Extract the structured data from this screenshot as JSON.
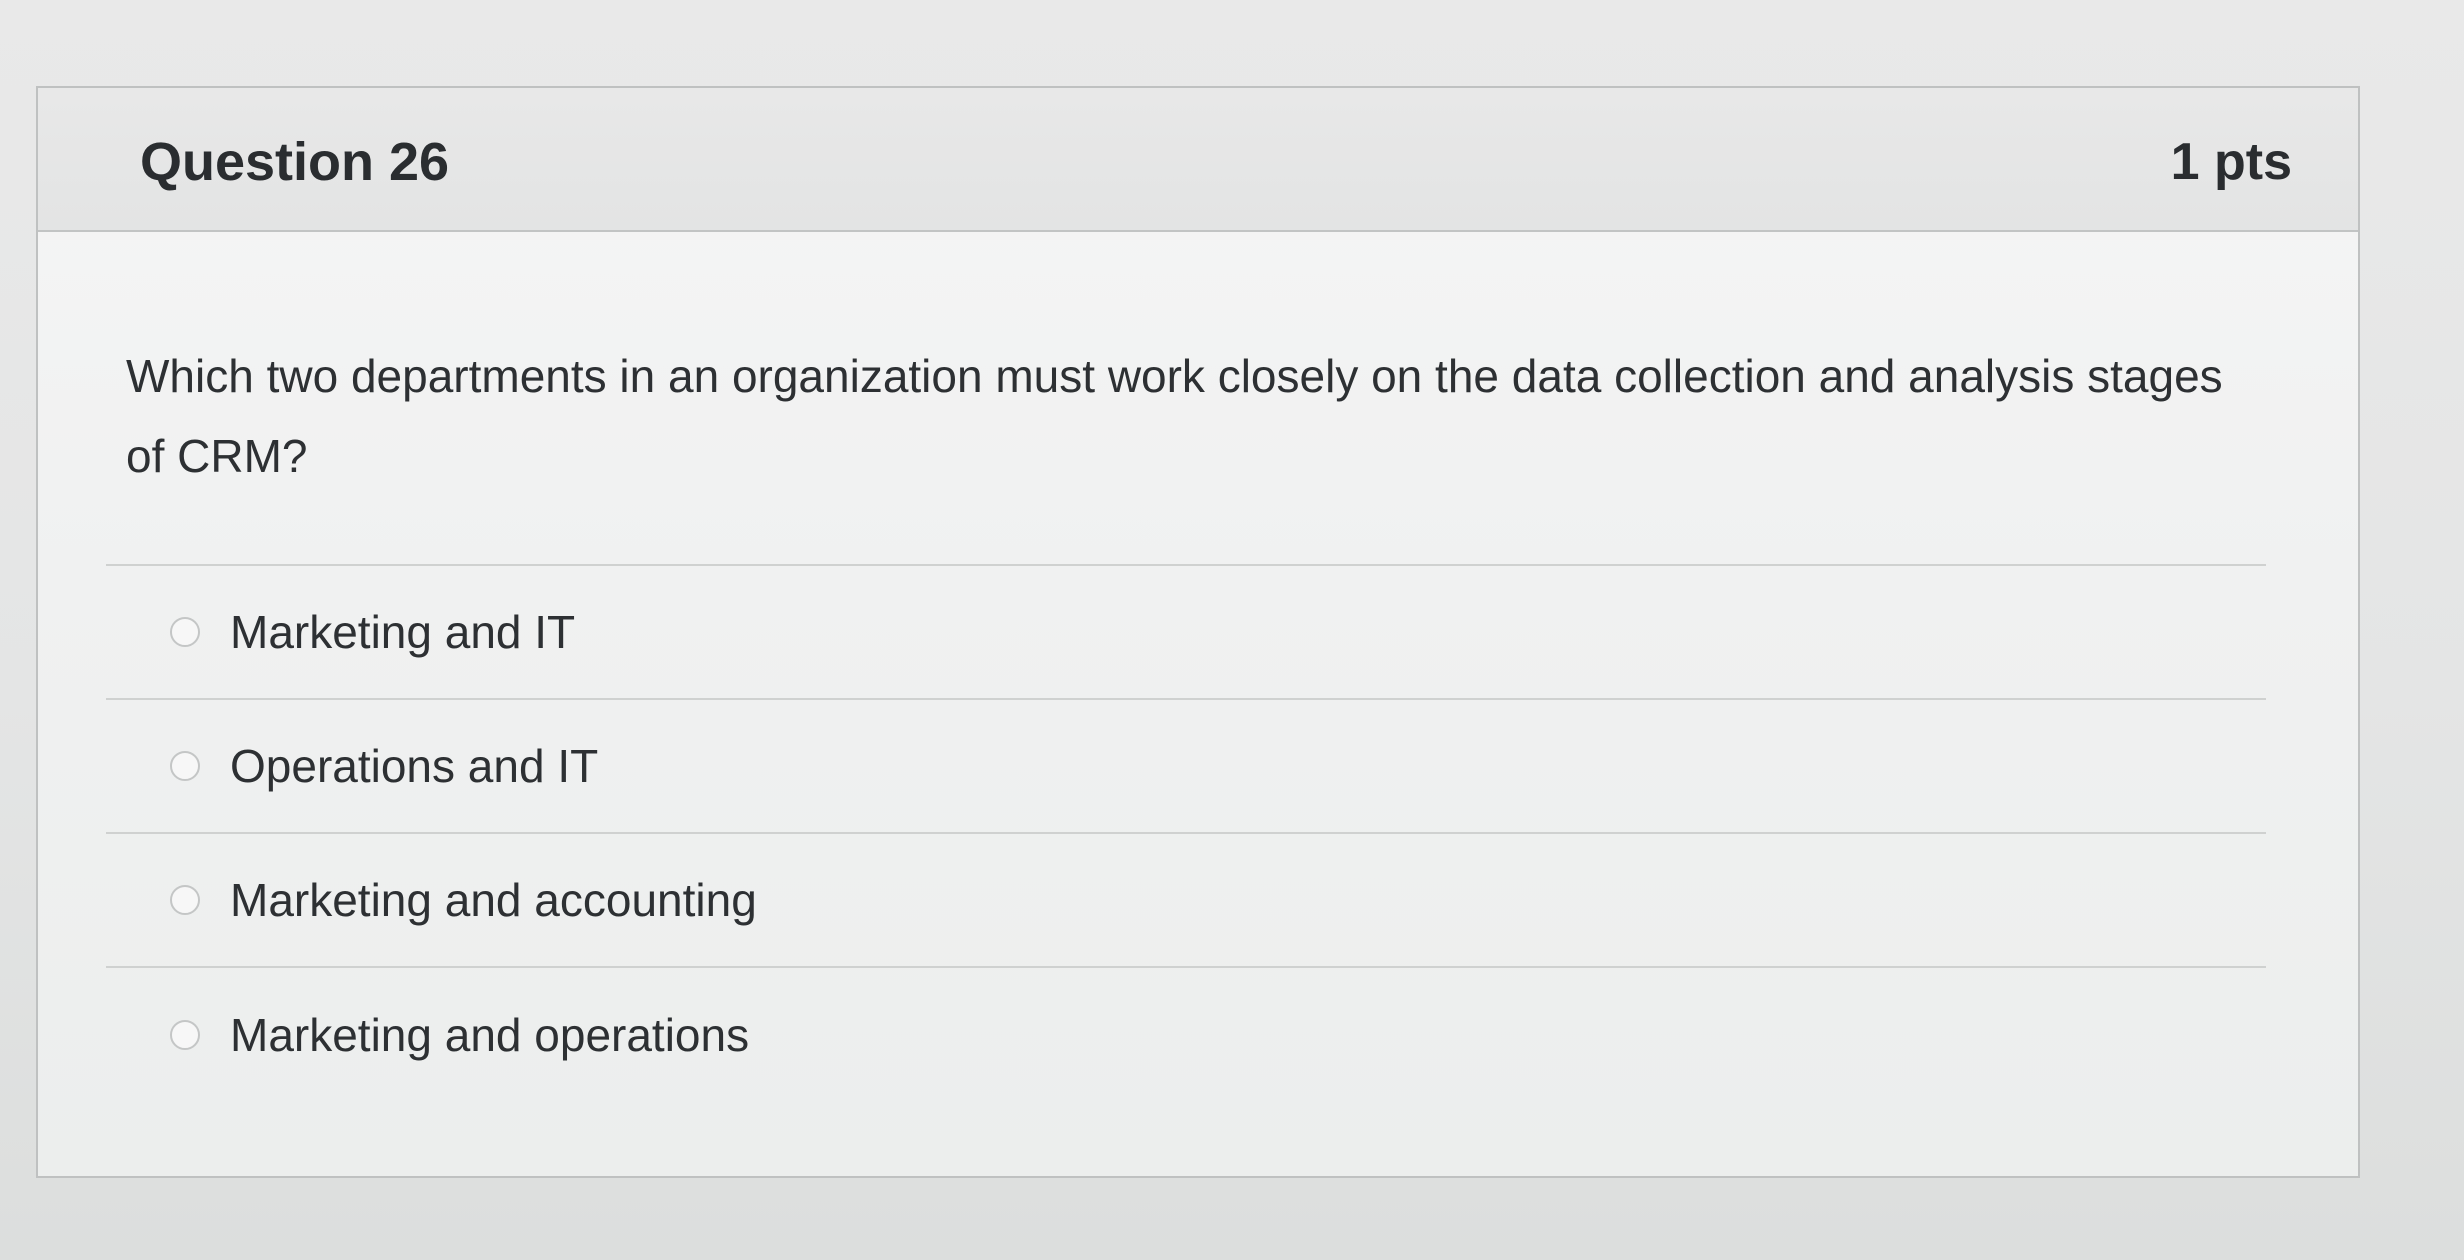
{
  "question": {
    "title": "Question 26",
    "points": "1 pts",
    "text": "Which two departments in an organization must work closely on the data collection and analysis stages of CRM?",
    "options": [
      {
        "label": "Marketing and IT",
        "selected": false
      },
      {
        "label": "Operations and IT",
        "selected": false
      },
      {
        "label": "Marketing and accounting",
        "selected": false
      },
      {
        "label": "Marketing and operations",
        "selected": false
      }
    ]
  }
}
